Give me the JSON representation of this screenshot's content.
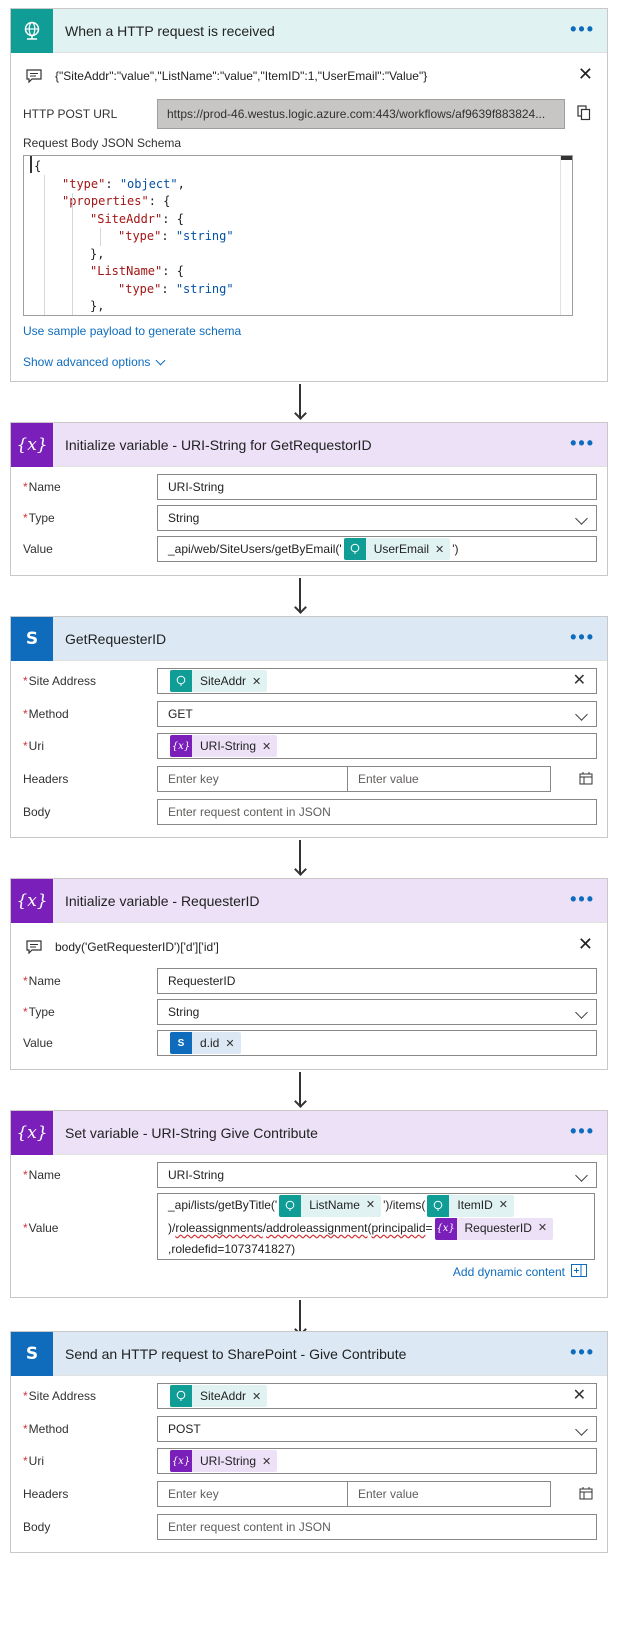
{
  "trigger": {
    "title": "When a HTTP request is received",
    "comment": "{\"SiteAddr\":\"value\",\"ListName\":\"value\",\"ItemID\":1,\"UserEmail\":\"Value\"}",
    "url_label": "HTTP POST URL",
    "url_value": "https://prod-46.westus.logic.azure.com:443/workflows/af9639f883824...",
    "schema_label": "Request Body JSON Schema",
    "schema_lines": [
      {
        "indent": 0,
        "key": "",
        "sep": "",
        "val": "",
        "tail": "{"
      },
      {
        "indent": 1,
        "key": "\"type\"",
        "sep": ": ",
        "val": "\"object\"",
        "tail": ","
      },
      {
        "indent": 1,
        "key": "\"properties\"",
        "sep": ": ",
        "val": "",
        "tail": "{"
      },
      {
        "indent": 2,
        "key": "\"SiteAddr\"",
        "sep": ": ",
        "val": "",
        "tail": "{"
      },
      {
        "indent": 3,
        "key": "\"type\"",
        "sep": ": ",
        "val": "\"string\"",
        "tail": ""
      },
      {
        "indent": 2,
        "key": "",
        "sep": "",
        "val": "",
        "tail": "},"
      },
      {
        "indent": 2,
        "key": "\"ListName\"",
        "sep": ": ",
        "val": "",
        "tail": "{"
      },
      {
        "indent": 3,
        "key": "\"type\"",
        "sep": ": ",
        "val": "\"string\"",
        "tail": ""
      },
      {
        "indent": 2,
        "key": "",
        "sep": "",
        "val": "",
        "tail": "},"
      }
    ],
    "sample_link": "Use sample payload to generate schema",
    "advanced_link": "Show advanced options"
  },
  "init1": {
    "title": "Initialize variable - URI-String for GetRequestorID",
    "name_label": "Name",
    "name_value": "URI-String",
    "type_label": "Type",
    "type_value": "String",
    "value_label": "Value",
    "value_prefix": "_api/web/SiteUsers/getByEmail('",
    "value_token": "UserEmail",
    "value_suffix": "')"
  },
  "get": {
    "title": "GetRequesterID",
    "site_label": "Site Address",
    "site_token": "SiteAddr",
    "method_label": "Method",
    "method_value": "GET",
    "uri_label": "Uri",
    "uri_token": "URI-String",
    "headers_label": "Headers",
    "key_ph": "Enter key",
    "value_ph": "Enter value",
    "body_label": "Body",
    "body_ph": "Enter request content in JSON"
  },
  "init2": {
    "title": "Initialize variable - RequesterID",
    "comment": "body('GetRequesterID')['d']['id']",
    "name_label": "Name",
    "name_value": "RequesterID",
    "type_label": "Type",
    "type_value": "String",
    "value_label": "Value",
    "value_token": "d.id"
  },
  "setvar": {
    "title": "Set variable - URI-String Give Contribute",
    "name_label": "Name",
    "name_value": "URI-String",
    "value_label": "Value",
    "l1_prefix": "_api/lists/getByTitle('",
    "l1_token1": "ListName",
    "l1_mid": "')/items(",
    "l1_token2": "ItemID",
    "l2_prefix": ")/",
    "l2_sq1": "roleassignments",
    "l2_slash": "/",
    "l2_sq2": "addroleassignment",
    "l2_open": "(",
    "l2_sq3": "principalid",
    "l2_eq": "=",
    "l2_token": "RequesterID",
    "l3": ",roledefid=1073741827)",
    "dynamic_link": "Add dynamic content"
  },
  "send": {
    "title": "Send an HTTP request to SharePoint - Give Contribute",
    "site_label": "Site Address",
    "site_token": "SiteAddr",
    "method_label": "Method",
    "method_value": "POST",
    "uri_label": "Uri",
    "uri_token": "URI-String",
    "headers_label": "Headers",
    "key_ph": "Enter key",
    "value_ph": "Enter value",
    "body_label": "Body",
    "body_ph": "Enter request content in JSON"
  },
  "icons": {
    "more": "•••",
    "close": "✕",
    "token_close": "✕",
    "colors": {
      "teal": "#0f9d95",
      "purple": "#7a1fba",
      "blue": "#0f6cbd"
    }
  }
}
